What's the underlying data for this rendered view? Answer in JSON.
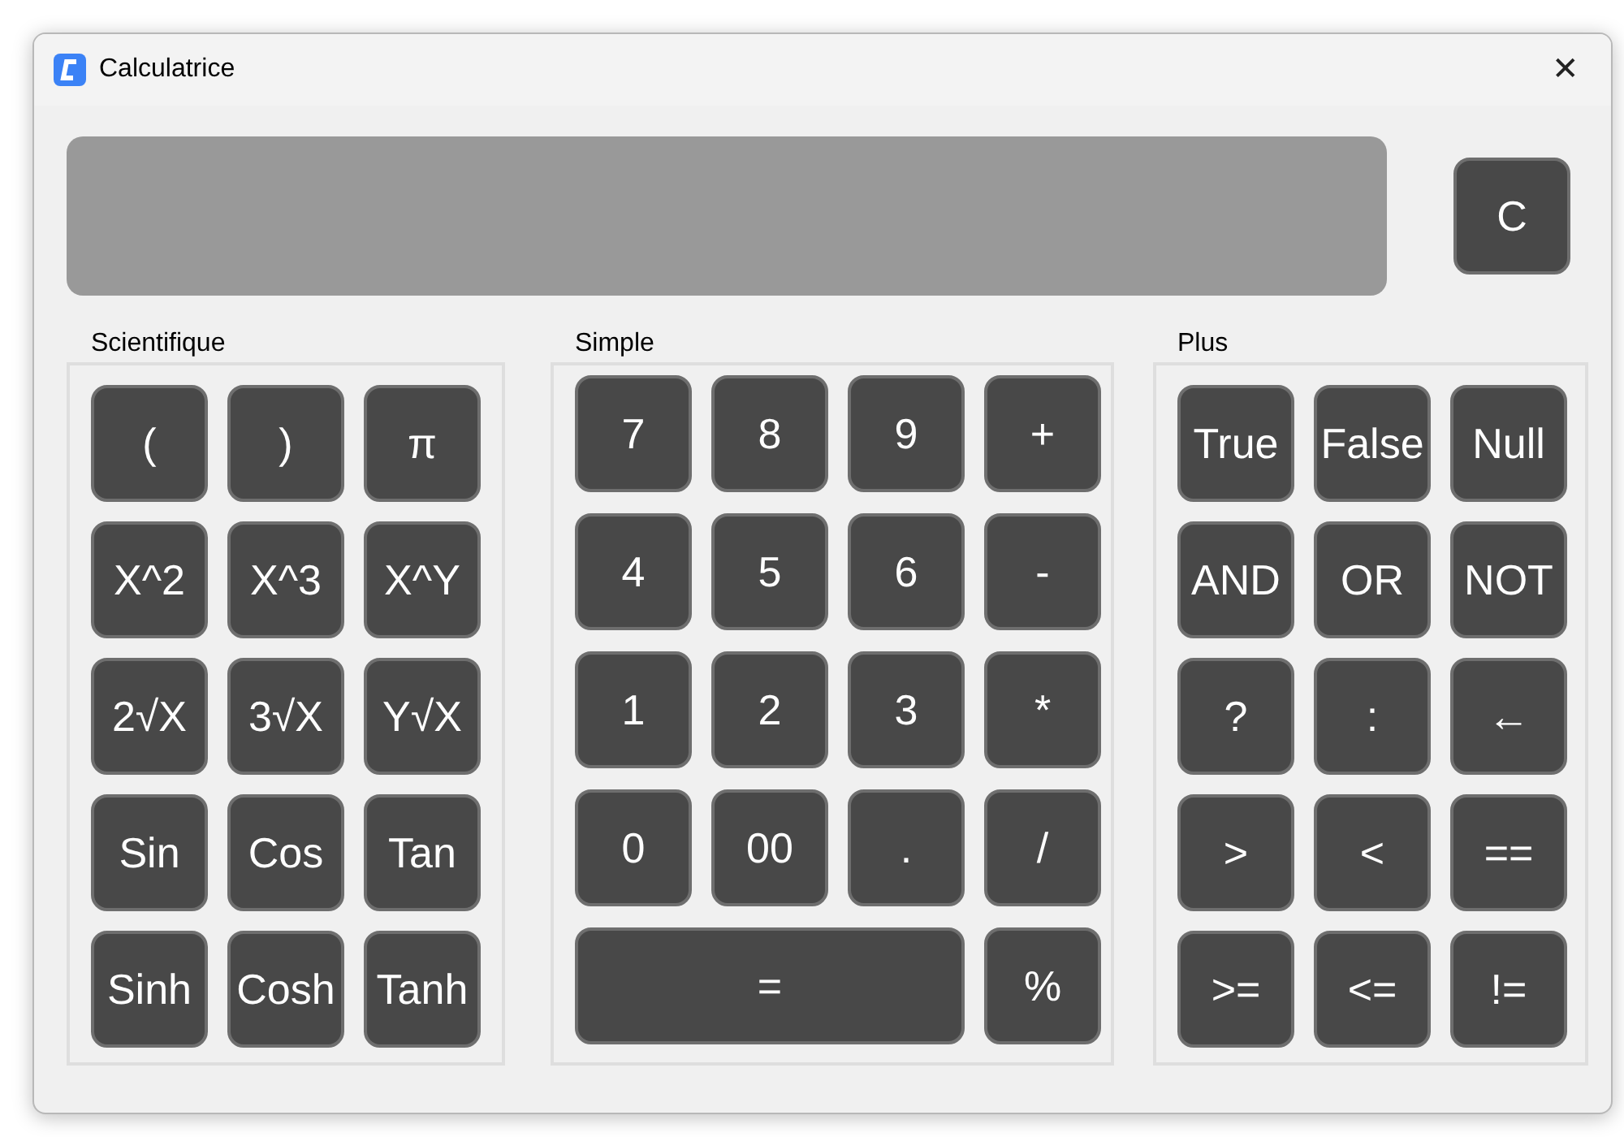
{
  "window": {
    "title": "Calculatrice",
    "close": "✕"
  },
  "display": {
    "clear": "C"
  },
  "groups": [
    {
      "title": "Scientifique",
      "keys": [
        {
          "label": "(",
          "kind": "key"
        },
        {
          "label": ")",
          "kind": "key"
        },
        {
          "label": "π",
          "kind": "key"
        },
        {
          "label": "X^2",
          "kind": "key"
        },
        {
          "label": "X^3",
          "kind": "key"
        },
        {
          "label": "X^Y",
          "kind": "key"
        },
        {
          "label": "2√X",
          "kind": "key"
        },
        {
          "label": "3√X",
          "kind": "key"
        },
        {
          "label": "Y√X",
          "kind": "key"
        },
        {
          "label": "Sin",
          "kind": "key"
        },
        {
          "label": "Cos",
          "kind": "key"
        },
        {
          "label": "Tan",
          "kind": "key"
        },
        {
          "label": "Sinh",
          "kind": "key"
        },
        {
          "label": "Cosh",
          "kind": "key"
        },
        {
          "label": "Tanh",
          "kind": "key"
        }
      ]
    },
    {
      "title": "Simple",
      "keys": [
        {
          "label": "7",
          "kind": "key"
        },
        {
          "label": "8",
          "kind": "key"
        },
        {
          "label": "9",
          "kind": "key"
        },
        {
          "label": "+",
          "kind": "key"
        },
        {
          "label": "4",
          "kind": "key"
        },
        {
          "label": "5",
          "kind": "key"
        },
        {
          "label": "6",
          "kind": "key"
        },
        {
          "label": "-",
          "kind": "key"
        },
        {
          "label": "1",
          "kind": "key"
        },
        {
          "label": "2",
          "kind": "key"
        },
        {
          "label": "3",
          "kind": "key"
        },
        {
          "label": "*",
          "kind": "key"
        },
        {
          "label": "0",
          "kind": "key"
        },
        {
          "label": "00",
          "kind": "key"
        },
        {
          "label": ".",
          "kind": "key"
        },
        {
          "label": "/",
          "kind": "key"
        },
        {
          "label": "=",
          "kind": "wide"
        },
        {
          "label": "%",
          "kind": "key"
        }
      ]
    },
    {
      "title": "Plus",
      "keys": [
        {
          "label": "True",
          "kind": "key"
        },
        {
          "label": "False",
          "kind": "key"
        },
        {
          "label": "Null",
          "kind": "key"
        },
        {
          "label": "AND",
          "kind": "key"
        },
        {
          "label": "OR",
          "kind": "key"
        },
        {
          "label": "NOT",
          "kind": "key"
        },
        {
          "label": "?",
          "kind": "key"
        },
        {
          "label": ":",
          "kind": "key"
        },
        {
          "label": "←",
          "kind": "key"
        },
        {
          "label": ">",
          "kind": "key"
        },
        {
          "label": "<",
          "kind": "key"
        },
        {
          "label": "==",
          "kind": "key"
        },
        {
          "label": ">=",
          "kind": "key"
        },
        {
          "label": "<=",
          "kind": "key"
        },
        {
          "label": "!=",
          "kind": "key"
        }
      ]
    }
  ]
}
